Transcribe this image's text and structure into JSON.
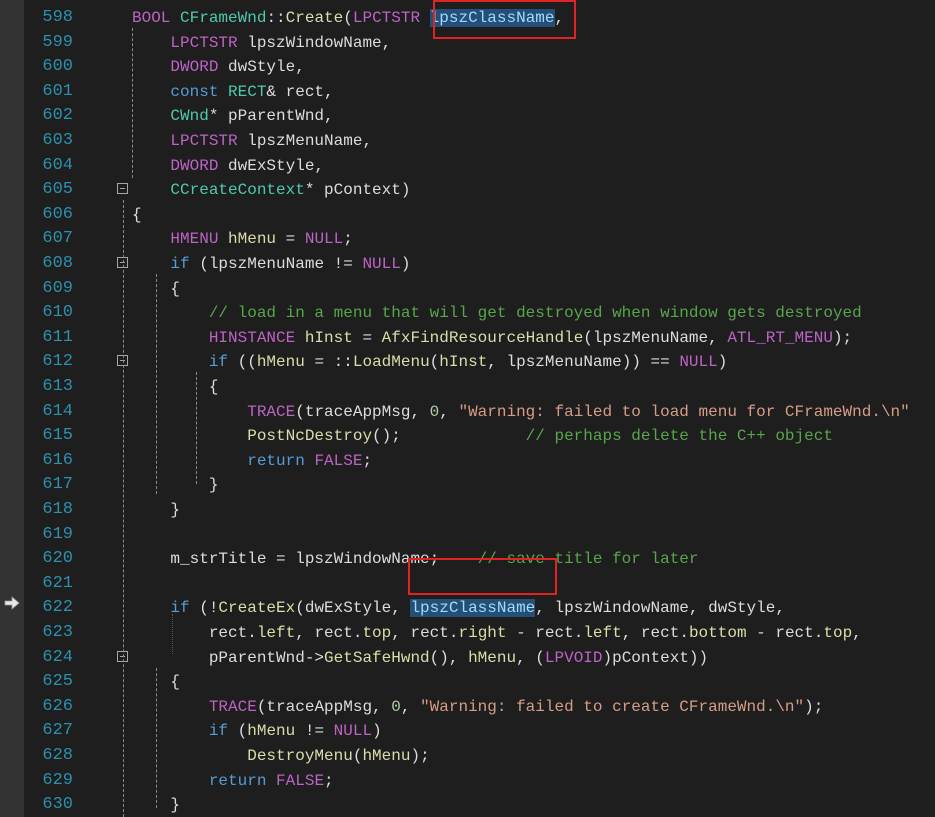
{
  "colors": {
    "background": "#1e1e1e",
    "line_number": "#2b91af",
    "keyword": "#569cd6",
    "type": "#4ec9b0",
    "function": "#dcdcaa",
    "macro": "#bd63c5",
    "string": "#d69d85",
    "comment": "#57a64a",
    "selection": "#264f78",
    "annotation_box": "#e02424"
  },
  "icons": {
    "breakpoint_arrow": "current-statement-arrow-icon",
    "fold_toggle": "collapse-minus-icon"
  },
  "lines": [
    {
      "num": "598",
      "fold": false,
      "tokens": [
        {
          "t": "BOOL ",
          "c": "mac"
        },
        {
          "t": "CFrameWnd",
          "c": "ty"
        },
        {
          "t": "::",
          "c": ""
        },
        {
          "t": "Create",
          "c": "fn"
        },
        {
          "t": "(",
          "c": ""
        },
        {
          "t": "LPCTSTR ",
          "c": "mac"
        },
        {
          "t": "lpszClassName",
          "c": "hl"
        },
        {
          "t": ",",
          "c": ""
        }
      ]
    },
    {
      "num": "599",
      "fold": false,
      "tokens": [
        {
          "t": "    LPCTSTR ",
          "c": "mac"
        },
        {
          "t": "lpszWindowName,",
          "c": ""
        }
      ]
    },
    {
      "num": "600",
      "fold": false,
      "tokens": [
        {
          "t": "    DWORD ",
          "c": "mac"
        },
        {
          "t": "dwStyle,",
          "c": ""
        }
      ]
    },
    {
      "num": "601",
      "fold": false,
      "tokens": [
        {
          "t": "    const ",
          "c": "kw"
        },
        {
          "t": "RECT",
          "c": "ty"
        },
        {
          "t": "& rect,",
          "c": ""
        }
      ]
    },
    {
      "num": "602",
      "fold": false,
      "tokens": [
        {
          "t": "    CWnd",
          "c": "ty"
        },
        {
          "t": "* pParentWnd,",
          "c": ""
        }
      ]
    },
    {
      "num": "603",
      "fold": false,
      "tokens": [
        {
          "t": "    LPCTSTR ",
          "c": "mac"
        },
        {
          "t": "lpszMenuName,",
          "c": ""
        }
      ]
    },
    {
      "num": "604",
      "fold": false,
      "tokens": [
        {
          "t": "    DWORD ",
          "c": "mac"
        },
        {
          "t": "dwExStyle,",
          "c": ""
        }
      ]
    },
    {
      "num": "605",
      "fold": true,
      "tokens": [
        {
          "t": "    CCreateContext",
          "c": "ty"
        },
        {
          "t": "* pContext)",
          "c": ""
        }
      ]
    },
    {
      "num": "606",
      "fold": false,
      "tokens": [
        {
          "t": "{",
          "c": ""
        }
      ]
    },
    {
      "num": "607",
      "fold": false,
      "tokens": [
        {
          "t": "    HMENU ",
          "c": "mac"
        },
        {
          "t": "hMenu",
          "c": "fn"
        },
        {
          "t": " = ",
          "c": ""
        },
        {
          "t": "NULL",
          "c": "mac"
        },
        {
          "t": ";",
          "c": ""
        }
      ]
    },
    {
      "num": "608",
      "fold": true,
      "tokens": [
        {
          "t": "    if ",
          "c": "kw"
        },
        {
          "t": "(lpszMenuName != ",
          "c": ""
        },
        {
          "t": "NULL",
          "c": "mac"
        },
        {
          "t": ")",
          "c": ""
        }
      ]
    },
    {
      "num": "609",
      "fold": false,
      "tokens": [
        {
          "t": "    {",
          "c": ""
        }
      ]
    },
    {
      "num": "610",
      "fold": false,
      "tokens": [
        {
          "t": "        // load in a menu that will get destroyed when window gets destroyed",
          "c": "cm"
        }
      ]
    },
    {
      "num": "611",
      "fold": false,
      "tokens": [
        {
          "t": "        HINSTANCE ",
          "c": "mac"
        },
        {
          "t": "hInst",
          "c": "fn"
        },
        {
          "t": " = ",
          "c": ""
        },
        {
          "t": "AfxFindResourceHandle",
          "c": "fn"
        },
        {
          "t": "(lpszMenuName, ",
          "c": ""
        },
        {
          "t": "ATL_RT_MENU",
          "c": "mac"
        },
        {
          "t": ");",
          "c": ""
        }
      ]
    },
    {
      "num": "612",
      "fold": true,
      "tokens": [
        {
          "t": "        if ",
          "c": "kw"
        },
        {
          "t": "((",
          "c": ""
        },
        {
          "t": "hMenu",
          "c": "fn"
        },
        {
          "t": " = ::",
          "c": ""
        },
        {
          "t": "LoadMenu",
          "c": "fn"
        },
        {
          "t": "(",
          "c": ""
        },
        {
          "t": "hInst",
          "c": "fn"
        },
        {
          "t": ", lpszMenuName)) == ",
          "c": ""
        },
        {
          "t": "NULL",
          "c": "mac"
        },
        {
          "t": ")",
          "c": ""
        }
      ]
    },
    {
      "num": "613",
      "fold": false,
      "tokens": [
        {
          "t": "        {",
          "c": ""
        }
      ]
    },
    {
      "num": "614",
      "fold": false,
      "tokens": [
        {
          "t": "            TRACE",
          "c": "mac"
        },
        {
          "t": "(traceAppMsg, ",
          "c": ""
        },
        {
          "t": "0",
          "c": "num"
        },
        {
          "t": ", ",
          "c": ""
        },
        {
          "t": "\"Warning: failed to load menu for CFrameWnd.\\n\"",
          "c": "str"
        }
      ]
    },
    {
      "num": "615",
      "fold": false,
      "tokens": [
        {
          "t": "            PostNcDestroy",
          "c": "fn"
        },
        {
          "t": "();             ",
          "c": ""
        },
        {
          "t": "// perhaps delete the C++ object",
          "c": "cm"
        }
      ]
    },
    {
      "num": "616",
      "fold": false,
      "tokens": [
        {
          "t": "            return ",
          "c": "kw"
        },
        {
          "t": "FALSE",
          "c": "mac"
        },
        {
          "t": ";",
          "c": ""
        }
      ]
    },
    {
      "num": "617",
      "fold": false,
      "tokens": [
        {
          "t": "        }",
          "c": ""
        }
      ]
    },
    {
      "num": "618",
      "fold": false,
      "tokens": [
        {
          "t": "    }",
          "c": ""
        }
      ]
    },
    {
      "num": "619",
      "fold": false,
      "tokens": []
    },
    {
      "num": "620",
      "fold": false,
      "tokens": [
        {
          "t": "    m_strTitle = lpszWindowName;    ",
          "c": ""
        },
        {
          "t": "// save title for later",
          "c": "cm"
        }
      ]
    },
    {
      "num": "621",
      "fold": false,
      "tokens": []
    },
    {
      "num": "622",
      "fold": false,
      "tokens": [
        {
          "t": "    if ",
          "c": "kw"
        },
        {
          "t": "(!",
          "c": ""
        },
        {
          "t": "CreateEx",
          "c": "fn"
        },
        {
          "t": "(dwExStyle, ",
          "c": ""
        },
        {
          "t": "lpszClassName",
          "c": "hl"
        },
        {
          "t": ", lpszWindowName, dwStyle,",
          "c": ""
        }
      ]
    },
    {
      "num": "623",
      "fold": false,
      "tokens": [
        {
          "t": "        rect.",
          "c": ""
        },
        {
          "t": "left",
          "c": "fn"
        },
        {
          "t": ", rect.",
          "c": ""
        },
        {
          "t": "top",
          "c": "fn"
        },
        {
          "t": ", rect.",
          "c": ""
        },
        {
          "t": "right",
          "c": "fn"
        },
        {
          "t": " - rect.",
          "c": ""
        },
        {
          "t": "left",
          "c": "fn"
        },
        {
          "t": ", rect.",
          "c": ""
        },
        {
          "t": "bottom",
          "c": "fn"
        },
        {
          "t": " - rect.",
          "c": ""
        },
        {
          "t": "top",
          "c": "fn"
        },
        {
          "t": ",",
          "c": ""
        }
      ]
    },
    {
      "num": "624",
      "fold": true,
      "tokens": [
        {
          "t": "        pParentWnd->",
          "c": ""
        },
        {
          "t": "GetSafeHwnd",
          "c": "fn"
        },
        {
          "t": "(), ",
          "c": ""
        },
        {
          "t": "hMenu",
          "c": "fn"
        },
        {
          "t": ", (",
          "c": ""
        },
        {
          "t": "LPVOID",
          "c": "mac"
        },
        {
          "t": ")pContext))",
          "c": ""
        }
      ]
    },
    {
      "num": "625",
      "fold": false,
      "tokens": [
        {
          "t": "    {",
          "c": ""
        }
      ]
    },
    {
      "num": "626",
      "fold": false,
      "tokens": [
        {
          "t": "        TRACE",
          "c": "mac"
        },
        {
          "t": "(traceAppMsg, ",
          "c": ""
        },
        {
          "t": "0",
          "c": "num"
        },
        {
          "t": ", ",
          "c": ""
        },
        {
          "t": "\"Warning: failed to create CFrameWnd.\\n\"",
          "c": "str"
        },
        {
          "t": ");",
          "c": ""
        }
      ]
    },
    {
      "num": "627",
      "fold": false,
      "tokens": [
        {
          "t": "        if ",
          "c": "kw"
        },
        {
          "t": "(",
          "c": ""
        },
        {
          "t": "hMenu",
          "c": "fn"
        },
        {
          "t": " != ",
          "c": ""
        },
        {
          "t": "NULL",
          "c": "mac"
        },
        {
          "t": ")",
          "c": ""
        }
      ]
    },
    {
      "num": "628",
      "fold": false,
      "tokens": [
        {
          "t": "            DestroyMenu",
          "c": "fn"
        },
        {
          "t": "(",
          "c": ""
        },
        {
          "t": "hMenu",
          "c": "fn"
        },
        {
          "t": ");",
          "c": ""
        }
      ]
    },
    {
      "num": "629",
      "fold": false,
      "tokens": [
        {
          "t": "        return ",
          "c": "kw"
        },
        {
          "t": "FALSE",
          "c": "mac"
        },
        {
          "t": ";",
          "c": ""
        }
      ]
    },
    {
      "num": "630",
      "fold": false,
      "tokens": [
        {
          "t": "    }",
          "c": ""
        }
      ]
    }
  ]
}
